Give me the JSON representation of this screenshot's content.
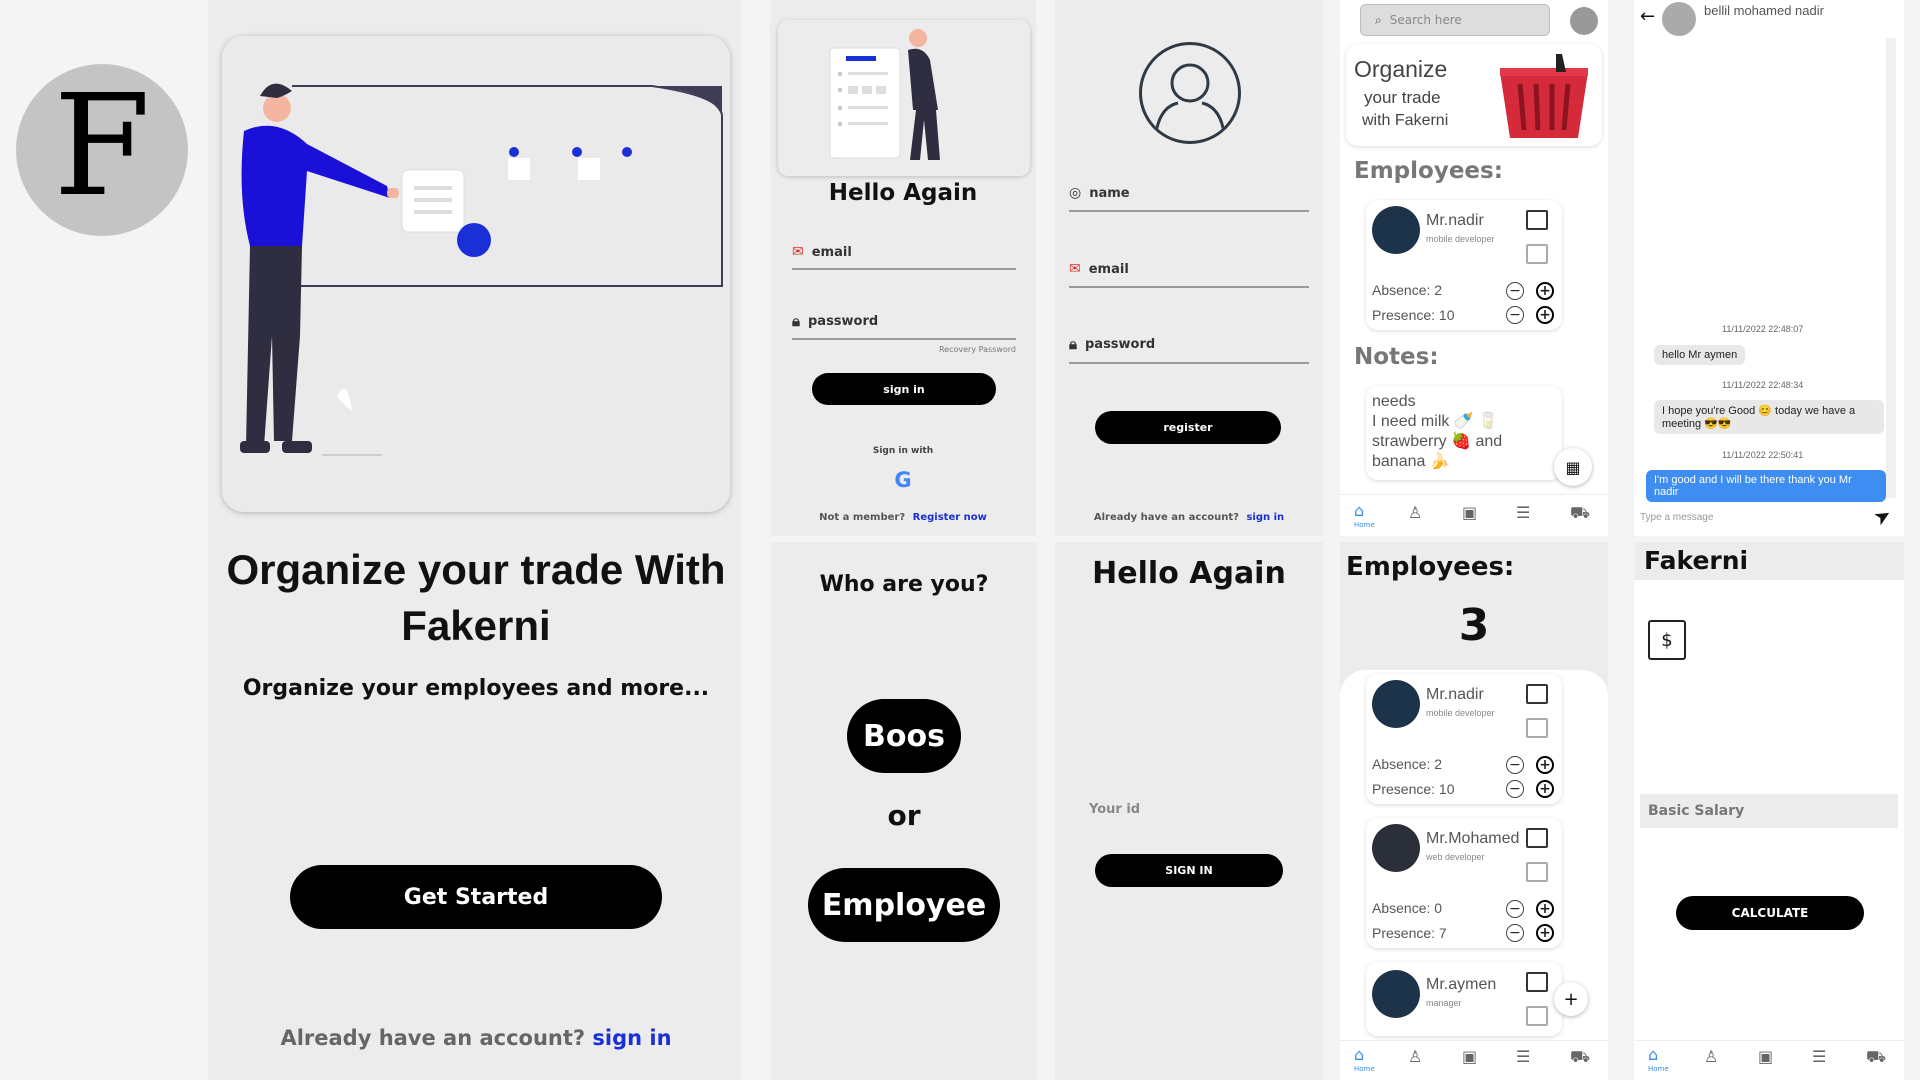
{
  "logo": {
    "letter": "F"
  },
  "landing": {
    "title": "Organize your trade With Fakerni",
    "subtitle": "Organize your employees and more...",
    "cta": "Get Started",
    "footer_text": "Already have an account?",
    "footer_link": "sign in"
  },
  "login": {
    "title": "Hello Again",
    "email_placeholder": "email",
    "password_placeholder": "password",
    "recovery": "Recovery Password",
    "button": "sign in",
    "sign_in_with": "Sign in with",
    "google_glyph": "G",
    "not_member": "Not a member?",
    "register_link": "Register now"
  },
  "register": {
    "name_placeholder": "name",
    "email_placeholder": "email",
    "password_placeholder": "password",
    "button": "register",
    "already": "Already have an account?",
    "signin_link": "sign in"
  },
  "who": {
    "title": "Who are you?",
    "boss": "Boos",
    "or": "or",
    "employee": "Employee"
  },
  "id_login": {
    "title": "Hello Again",
    "id_placeholder": "Your id",
    "button": "SIGN IN"
  },
  "home": {
    "search_placeholder": "Search here",
    "banner_line1": "Organize",
    "banner_line2": "your trade",
    "banner_line3": "with Fakerni",
    "employees_heading": "Employees:",
    "notes_heading": "Notes:",
    "notes_lines": [
      "needs",
      "I need milk 🍼 🥛",
      "strawberry 🍓 and",
      "banana 🍌"
    ],
    "nav_home": "Home"
  },
  "employees_screen": {
    "heading": "Employees:",
    "count": "3",
    "nav_home": "Home"
  },
  "employees": [
    {
      "name": "Mr.nadir",
      "role": "mobile developer",
      "absence": "Absence: 2",
      "presence": "Presence: 10"
    },
    {
      "name": "Mr.Mohamed",
      "role": "web developer",
      "absence": "Absence: 0",
      "presence": "Presence: 7"
    },
    {
      "name": "Mr.aymen",
      "role": "manager"
    }
  ],
  "chat": {
    "contact": "bellil mohamed nadir",
    "messages": [
      {
        "time": "11/11/2022 22:48:07",
        "text": "hello Mr aymen",
        "mine": false
      },
      {
        "time": "11/11/2022 22:48:34",
        "text": "I hope you're Good 😊 today we have a meeting 😎😎",
        "mine": false
      },
      {
        "time": "11/11/2022 22:50:41",
        "text": "I'm good and I will be there thank you Mr nadir",
        "mine": true
      }
    ],
    "input_placeholder": "Type a message"
  },
  "salary": {
    "title": "Fakerni",
    "field_placeholder": "Basic Salary",
    "button": "CALCULATE",
    "nav_home": "Home"
  },
  "colors": {
    "accent_blue": "#1a2fd6",
    "dark_avatar": "#1d3349",
    "chat_blue": "#3d8ef0"
  }
}
